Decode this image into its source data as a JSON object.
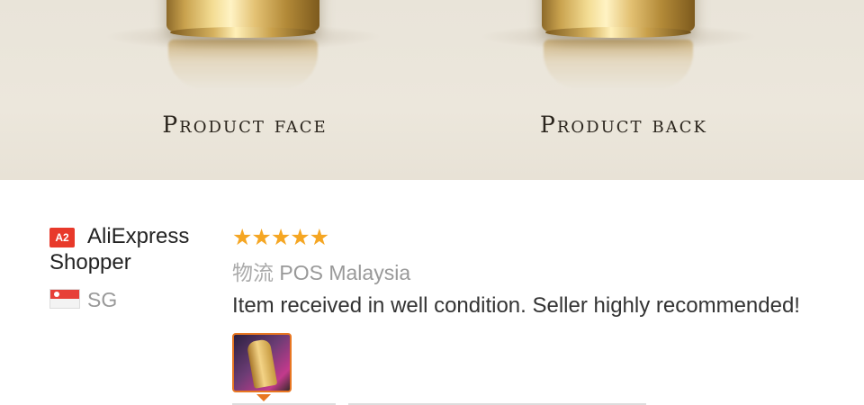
{
  "banner": {
    "captions": [
      "Product face",
      "Product back"
    ]
  },
  "reviewer": {
    "badge": "A2",
    "name": "AliExpress Shopper",
    "country": "SG",
    "flag_icon": "singapore-flag-icon"
  },
  "review": {
    "rating": 5,
    "stars": "★★★★★",
    "logistics_label": "物流",
    "logistics_value": "POS Malaysia",
    "comment": "Item received in well condition. Seller highly recommended!",
    "colors": {
      "star": "#f5a623",
      "accent": "#e87722",
      "badge": "#e8392a"
    }
  }
}
